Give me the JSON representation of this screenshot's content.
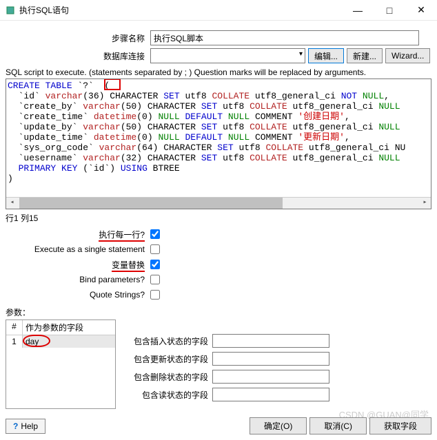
{
  "window": {
    "title": "执行SQL语句",
    "min": "—",
    "max": "□",
    "close": "✕"
  },
  "form": {
    "step_name_label": "步骤名称",
    "step_name_value": "执行SQL脚本",
    "db_conn_label": "数据库连接",
    "db_conn_value": "",
    "btn_edit": "编辑...",
    "btn_new": "新建...",
    "btn_wizard": "Wizard..."
  },
  "sql": {
    "desc": "SQL script to execute. (statements separated by ; ) Question marks will be replaced by arguments."
  },
  "position": "行1 列15",
  "options": {
    "each_row": "执行每一行?",
    "single_stmt": "Execute as a single statement",
    "var_sub": "变量替换",
    "bind_params": "Bind parameters?",
    "quote_strings": "Quote Strings?"
  },
  "params": {
    "label": "参数：",
    "col_num": "#",
    "col_field": "作为参数的字段",
    "rows": [
      {
        "num": "1",
        "field": "day"
      }
    ]
  },
  "status_fields": {
    "insert": "包含插入状态的字段",
    "update": "包含更新状态的字段",
    "delete": "包含删除状态的字段",
    "read": "包含读状态的字段"
  },
  "footer": {
    "help": "Help",
    "ok": "确定(O)",
    "cancel": "取消(C)",
    "get_fields": "获取字段"
  },
  "watermark": "CSDN @GUAN@同学"
}
